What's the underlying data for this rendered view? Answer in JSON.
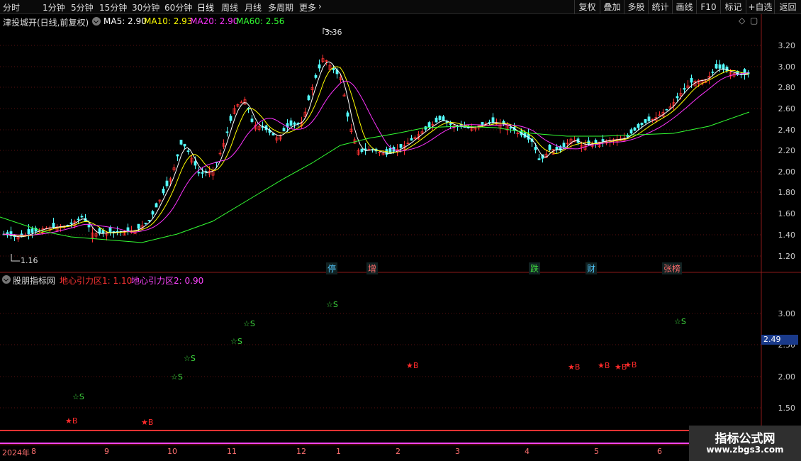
{
  "toolbar": {
    "periods": [
      "分时",
      "1分钟",
      "5分钟",
      "15分钟",
      "30分钟",
      "60分钟",
      "日线",
      "周线",
      "月线",
      "多周期",
      "更多"
    ],
    "active_period": "日线",
    "more_icon": "chevron-right-icon",
    "right_buttons": [
      "复权",
      "叠加",
      "多股",
      "统计",
      "画线",
      "F10",
      "标记",
      "+自选",
      "返回"
    ]
  },
  "main_chart": {
    "stock_title": "津投城开(日线,前复权)",
    "ma_legend": [
      {
        "label": "MA5: 2.90",
        "color": "#ffffff"
      },
      {
        "label": "MA10: 2.93",
        "color": "#ffff00"
      },
      {
        "label": "MA20: 2.90",
        "color": "#ff33ff"
      },
      {
        "label": "MA60: 2.56",
        "color": "#33ff33"
      }
    ],
    "y_ticks": [
      "3.20",
      "3.00",
      "2.80",
      "2.60",
      "2.40",
      "2.20",
      "2.00",
      "1.80",
      "1.60",
      "1.40",
      "1.20"
    ],
    "high_label": "3.36",
    "low_label": "1.16",
    "event_tags": [
      {
        "text": "停",
        "color": "#4fc3f7"
      },
      {
        "text": "增",
        "color": "#ff6b6b"
      },
      {
        "text": "跌",
        "color": "#3fdc3f"
      },
      {
        "text": "财",
        "color": "#4fc3f7"
      },
      {
        "text": "张榜",
        "color": "#ff6b6b"
      }
    ],
    "colors": {
      "up": "#ff3232",
      "down": "#54ffff",
      "ma5": "#ffffff",
      "ma10": "#ffff00",
      "ma20": "#ff33ff",
      "ma60": "#33ff33"
    }
  },
  "indicator": {
    "name": "股朋指标网",
    "lines": [
      {
        "label": "地心引力区1: 1.10",
        "color": "#ff3333"
      },
      {
        "label": "地心引力区2: 0.90",
        "color": "#ff44ff"
      }
    ],
    "y_ticks": [
      "3.00",
      "2.50",
      "2.00",
      "1.50"
    ],
    "current_value": "2.49",
    "signals": [
      {
        "text": "☆S",
        "type": "s"
      },
      {
        "text": "★B",
        "type": "b"
      },
      {
        "text": "★B",
        "type": "b"
      },
      {
        "text": "☆S",
        "type": "s"
      },
      {
        "text": "☆S",
        "type": "s"
      },
      {
        "text": "☆S",
        "type": "s"
      },
      {
        "text": "☆S",
        "type": "s"
      },
      {
        "text": "☆S",
        "type": "s"
      },
      {
        "text": "★B",
        "type": "b"
      },
      {
        "text": "★B",
        "type": "b"
      },
      {
        "text": "★B",
        "type": "b"
      },
      {
        "text": "★B",
        "type": "b"
      },
      {
        "text": "★B",
        "type": "b"
      },
      {
        "text": "☆S",
        "type": "s"
      }
    ]
  },
  "time_axis": {
    "labels": [
      "2024年",
      "8",
      "9",
      "10",
      "11",
      "12",
      "1",
      "2",
      "3",
      "4",
      "5",
      "6"
    ]
  },
  "watermark": {
    "title": "指标公式网",
    "url": "www.zbgs3.com"
  }
}
